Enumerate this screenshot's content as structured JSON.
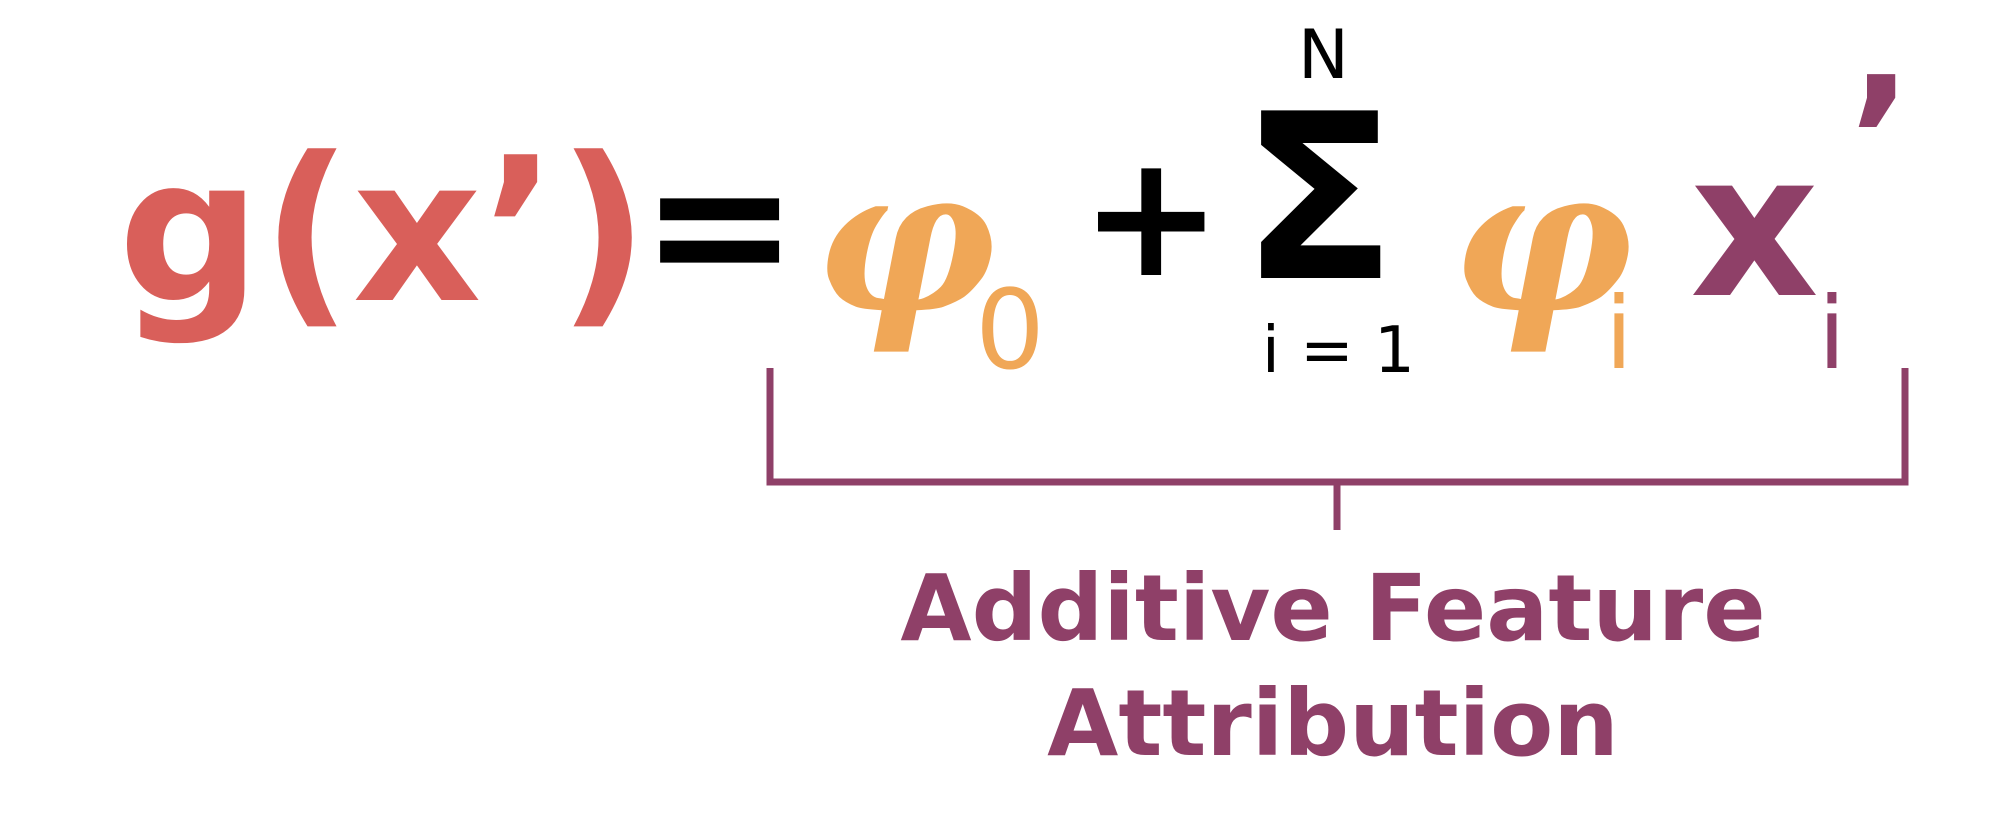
{
  "colors": {
    "lhs": "#d95f5a",
    "operator": "#000000",
    "phi": "#f0a757",
    "x": "#8f4068",
    "caption": "#8f4068"
  },
  "equation": {
    "lhs": "g(x’)",
    "equals": "=",
    "phi0": "φ",
    "phi0_sub": "0",
    "plus": "+",
    "sigma": "Σ",
    "sigma_upper": "N",
    "sigma_lower": "i = 1",
    "phi_i": "φ",
    "phi_i_sub": "i",
    "x_i": "x",
    "x_i_sub": "i",
    "x_i_prime": "’"
  },
  "caption": {
    "line1": "Additive Feature",
    "line2": "Attribution"
  }
}
